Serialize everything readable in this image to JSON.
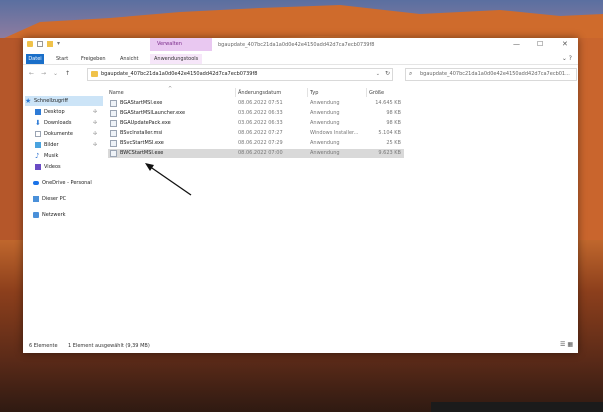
{
  "titlebar": {
    "context_tab": "Verwalten",
    "window_title": "bgaupdate_407bc21da1a0d0e42e4150add42d7ca7ecb0739f8",
    "minimize": "—",
    "maximize": "☐",
    "close": "✕"
  },
  "ribbon": {
    "file": "Datei",
    "tabs": [
      "Start",
      "Freigeben",
      "Ansicht",
      "Anwendungstools"
    ],
    "help": "⌄ ?"
  },
  "address": {
    "path": "bgaupdate_407bc21da1a0d0e42e4150add42d7ca7ecb0739f8",
    "search_placeholder": "bgaupdate_407bc21da1a0d0e42e4150add42d7ca7ecb01..."
  },
  "nav": {
    "items": [
      {
        "label": "Schnellzugriff",
        "icon": "star-icon",
        "color": "#2e7bd6"
      },
      {
        "label": "Desktop",
        "icon": "desktop-icon",
        "color": "#2e7bd6"
      },
      {
        "label": "Downloads",
        "icon": "download-icon",
        "color": "#2e7bd6"
      },
      {
        "label": "Dokumente",
        "icon": "document-icon",
        "color": "#9aa4b3"
      },
      {
        "label": "Bilder",
        "icon": "picture-icon",
        "color": "#4aa3df"
      },
      {
        "label": "Musik",
        "icon": "music-icon",
        "color": "#3a7bd5"
      },
      {
        "label": "Videos",
        "icon": "video-icon",
        "color": "#6a4bc4"
      },
      {
        "label": "OneDrive - Personal",
        "icon": "cloud-icon",
        "color": "#1a73e8"
      },
      {
        "label": "Dieser PC",
        "icon": "computer-icon",
        "color": "#4a90d9"
      },
      {
        "label": "Netzwerk",
        "icon": "network-icon",
        "color": "#4a90d9"
      }
    ]
  },
  "columns": {
    "name": "Name",
    "date": "Änderungsdatum",
    "type": "Typ",
    "size": "Größe"
  },
  "files": [
    {
      "name": "BGAStartMSI.exe",
      "date": "08.06.2022 07:51",
      "type": "Anwendung",
      "size": "14.645 KB"
    },
    {
      "name": "BGAStartMSILauncher.exe",
      "date": "03.06.2022 06:33",
      "type": "Anwendung",
      "size": "98 KB"
    },
    {
      "name": "BGAUpdatePack.exe",
      "date": "03.06.2022 06:33",
      "type": "Anwendung",
      "size": "98 KB"
    },
    {
      "name": "BSvcInstaller.msi",
      "date": "08.06.2022 07:27",
      "type": "Windows Installer...",
      "size": "5.104 KB"
    },
    {
      "name": "BSvcStartMSI.exe",
      "date": "08.06.2022 07:29",
      "type": "Anwendung",
      "size": "25 KB"
    },
    {
      "name": "BWCStartMSI.exe",
      "date": "08.06.2022 07:00",
      "type": "Anwendung",
      "size": "9.623 KB"
    }
  ],
  "status": {
    "count": "6 Elemente",
    "selection": "1 Element ausgewählt (9,39 MB)"
  },
  "colors": {
    "accent": "#1a6fc9",
    "context_tab": "#e9c8f1",
    "selection": "#d9d9d9",
    "nav_selection": "#cce4f7"
  }
}
